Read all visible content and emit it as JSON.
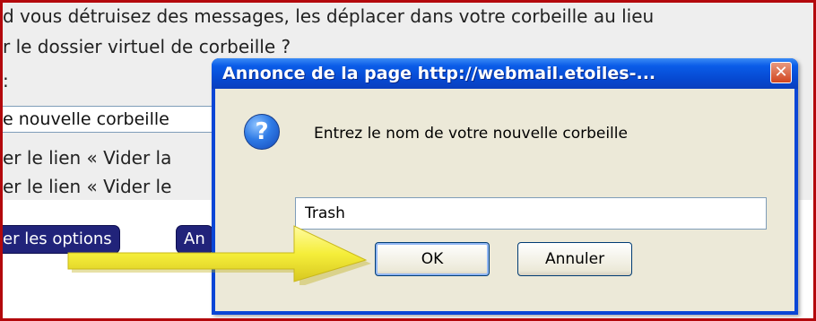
{
  "background_page": {
    "lines": [
      "d vous détruisez des messages, les déplacer dans votre corbeille au lieu",
      "r le dossier virtuel de corbeille ?",
      ":"
    ],
    "new_trash_field": "e nouvelle corbeille ",
    "option_lines": [
      "er le lien « Vider la",
      "er le lien « Vider le"
    ],
    "buttons": [
      "er les options",
      "An"
    ]
  },
  "dialog": {
    "title": "Annonce de la page  http://webmail.etoiles-...",
    "close_symbol": "✕",
    "icon": "question-icon",
    "message": "Entrez le nom de votre nouvelle corbeille",
    "input_value": "Trash",
    "ok_label": "OK",
    "cancel_label": "Annuler"
  },
  "annotation": {
    "arrow_color": "#f5ee3a",
    "arrow_target": "OK"
  },
  "colors": {
    "frame": "#b3080c",
    "titlebar": "#0a5ce8",
    "page_button": "#21237a"
  }
}
